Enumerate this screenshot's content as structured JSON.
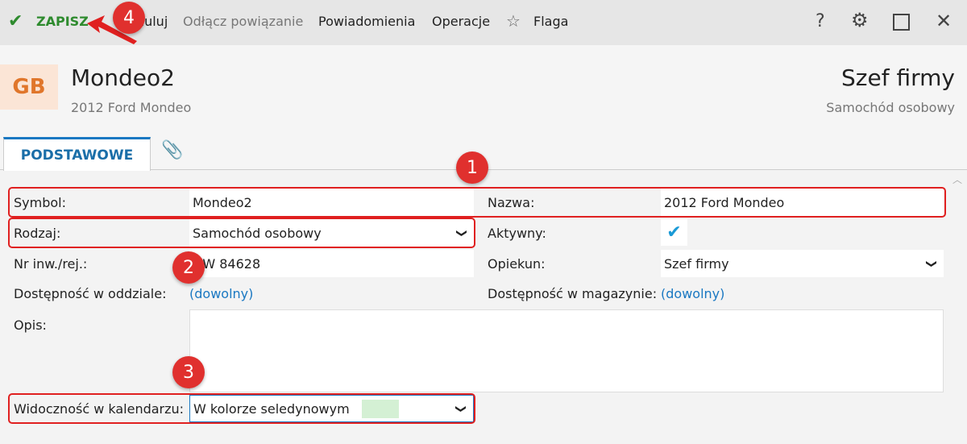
{
  "toolbar": {
    "save": "ZAPISZ",
    "cancel": "Anuluj",
    "unlink": "Odłącz powiązanie",
    "notifications": "Powiadomienia",
    "operations": "Operacje",
    "flag": "Flaga",
    "help": "?"
  },
  "header": {
    "avatar": "GB",
    "title": "Mondeo2",
    "subtitle": "2012 Ford Mondeo",
    "right_title": "Szef firmy",
    "right_subtitle": "Samochód osobowy"
  },
  "tabs": [
    {
      "label": "PODSTAWOWE",
      "active": true
    }
  ],
  "form": {
    "symbol": {
      "label": "Symbol:",
      "value": "Mondeo2"
    },
    "nazwa": {
      "label": "Nazwa:",
      "value": "2012 Ford Mondeo"
    },
    "rodzaj": {
      "label": "Rodzaj:",
      "value": "Samochód osobowy"
    },
    "aktywny": {
      "label": "Aktywny:",
      "checked": true
    },
    "nr": {
      "label": "Nr inw./rej.:",
      "value": "DW 84628"
    },
    "opiekun": {
      "label": "Opiekun:",
      "value": "Szef firmy"
    },
    "dost_oddzial": {
      "label": "Dostępność w oddziale:",
      "value": "(dowolny)"
    },
    "dost_magazyn": {
      "label": "Dostępność w magazynie:",
      "value": "(dowolny)"
    },
    "opis": {
      "label": "Opis:",
      "value": ""
    },
    "widocznosc": {
      "label": "Widoczność w kalendarzu:",
      "value": "W kolorze seledynowym",
      "swatch": "#d4f0d4"
    }
  },
  "annotations": [
    "1",
    "2",
    "3",
    "4"
  ],
  "colors": {
    "accent": "#1a78c2",
    "save": "#2e8b2e",
    "annotation": "#e0302e"
  }
}
